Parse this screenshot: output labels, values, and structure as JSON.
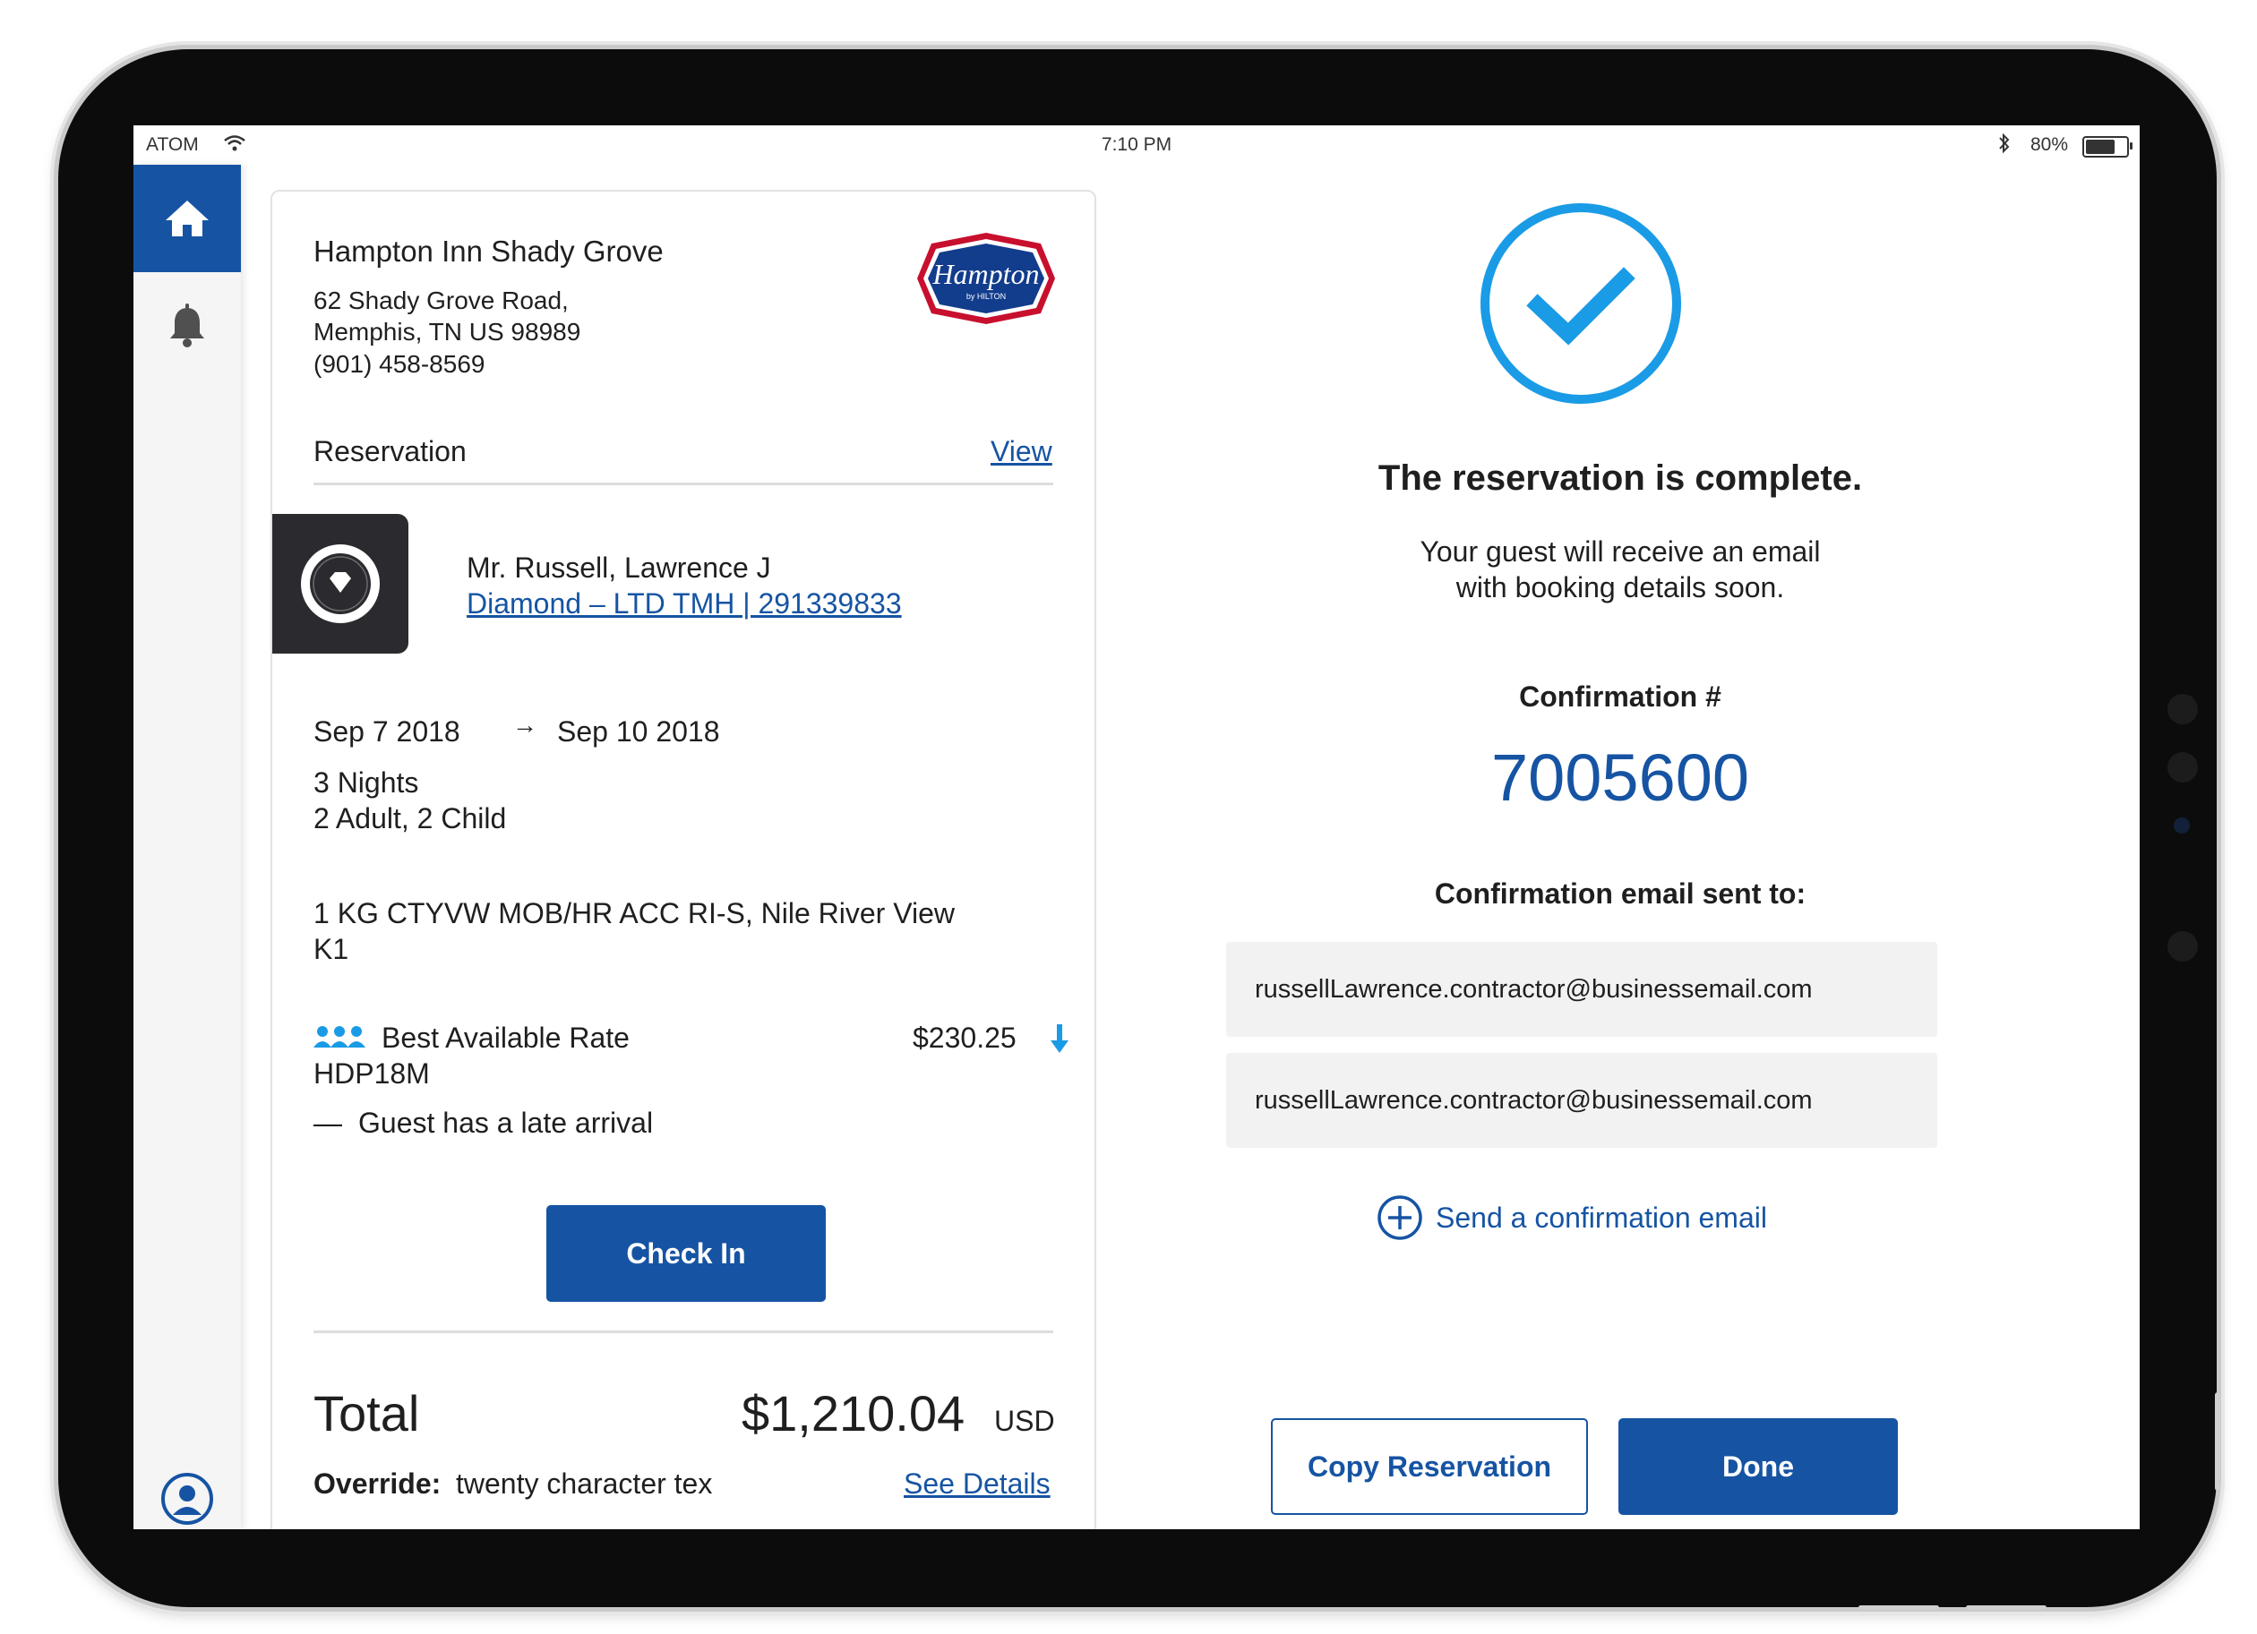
{
  "status_bar": {
    "carrier": "ATOM",
    "time": "7:10 PM",
    "battery": "80%",
    "battery_level": 0.8
  },
  "sidebar": {
    "items": [
      {
        "icon": "home-icon",
        "active": true
      },
      {
        "icon": "bell-icon",
        "active": false
      },
      {
        "icon": "user-avatar-icon",
        "active": false
      }
    ],
    "accent": "#1654a3"
  },
  "hotel": {
    "name": "Hampton Inn Shady Grove",
    "address_line1": "62 Shady Grove Road,",
    "address_line2": "Memphis, TN US 98989",
    "phone": "(901) 458-8569",
    "logo_text": "Hampton",
    "logo_sub": "by HILTON"
  },
  "reservation": {
    "label": "Reservation",
    "view_link": "View",
    "guest_name": "Mr. Russell, Lawrence J",
    "tier_link": "Diamond – LTD TMH | 291339833",
    "check_in_date": "Sep 7 2018",
    "arrow": "→",
    "check_out_date": "Sep 10 2018",
    "nights": "3 Nights",
    "occupancy": "2 Adult, 2 Child",
    "room_line1": "1 KG CTYVW MOB/HR ACC RI-S, Nile River View",
    "room_line2": "K1",
    "rate_name": "Best Available Rate",
    "rate_price": "$230.25",
    "rate_code": "HDP18M",
    "note_dash": "—",
    "note": "Guest has a late arrival",
    "check_in_button": "Check In",
    "total_label": "Total",
    "total_amount": "$1,210.04",
    "total_currency": "USD",
    "override_label": "Override:",
    "override_value": "twenty character tex",
    "see_details_link": "See Details"
  },
  "confirmation": {
    "title": "The reservation is complete.",
    "subtitle_line1": "Your guest will receive an email",
    "subtitle_line2": "with booking details soon.",
    "number_label": "Confirmation #",
    "number": "7005600",
    "emails_label": "Confirmation email sent to:",
    "emails": [
      "russellLawrence.contractor@businessemail.com",
      "russellLawrence.contractor@businessemail.com"
    ],
    "send_link": "Send a confirmation email",
    "copy_button": "Copy Reservation",
    "done_button": "Done",
    "check_color": "#1a9be6"
  }
}
